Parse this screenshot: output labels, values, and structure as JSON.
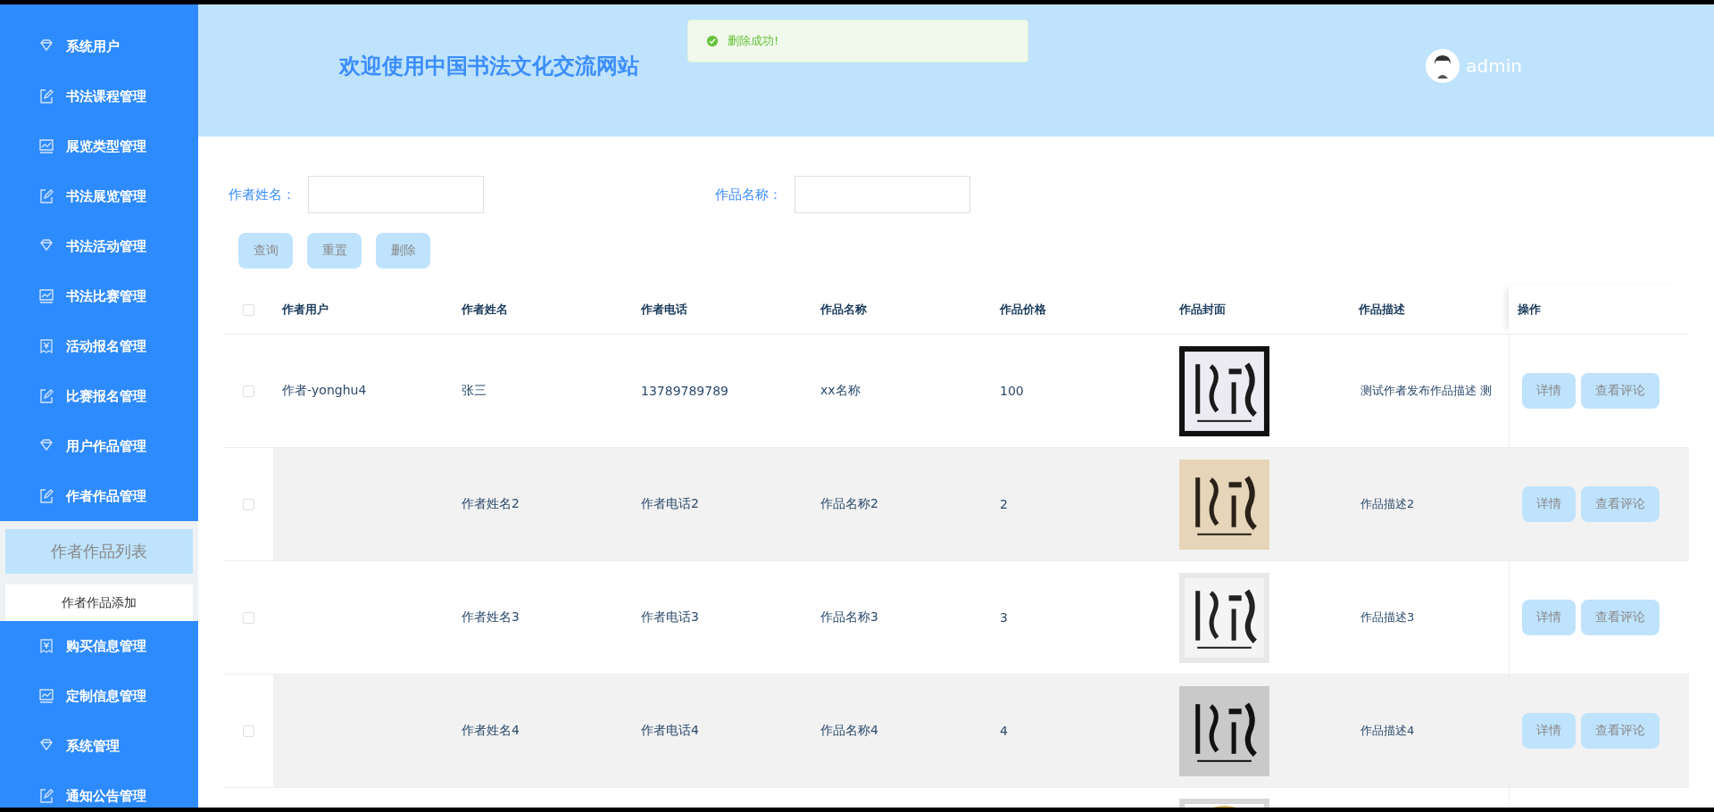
{
  "sidebar": {
    "items": [
      {
        "label": "系统用户",
        "kind": "diamond"
      },
      {
        "label": "书法课程管理",
        "kind": "edit"
      },
      {
        "label": "展览类型管理",
        "kind": "chart"
      },
      {
        "label": "书法展览管理",
        "kind": "edit"
      },
      {
        "label": "书法活动管理",
        "kind": "diamond"
      },
      {
        "label": "书法比赛管理",
        "kind": "chart"
      },
      {
        "label": "活动报名管理",
        "kind": "receipt"
      },
      {
        "label": "比赛报名管理",
        "kind": "edit"
      },
      {
        "label": "用户作品管理",
        "kind": "diamond"
      },
      {
        "label": "作者作品管理",
        "kind": "edit",
        "expanded": true,
        "children": [
          {
            "label": "作者作品列表",
            "selected": true
          },
          {
            "label": "作者作品添加",
            "selected": false
          }
        ]
      },
      {
        "label": "购买信息管理",
        "kind": "receipt"
      },
      {
        "label": "定制信息管理",
        "kind": "chart"
      },
      {
        "label": "系统管理",
        "kind": "diamond"
      },
      {
        "label": "通知公告管理",
        "kind": "edit"
      }
    ]
  },
  "header": {
    "title": "欢迎使用中国书法文化交流网站",
    "user": "admin"
  },
  "toast": {
    "kind": "success",
    "message": "删除成功!"
  },
  "filters": [
    {
      "label": "作者姓名："
    },
    {
      "label": "作品名称："
    }
  ],
  "buttons": [
    "查询",
    "重置",
    "删除"
  ],
  "table": {
    "header_checked": false,
    "columns": [
      "作者用户",
      "作者姓名",
      "作者电话",
      "作品名称",
      "作品价格",
      "作品封面",
      "作品描述",
      "操作"
    ],
    "rows": [
      {
        "checked": false,
        "user": "作者-yonghu4",
        "name": "张三",
        "phone": "13789789789",
        "title": "xx名称",
        "price": "100",
        "cover": {
          "kind": "picture"
        },
        "description": "测试作者发布作品描述 测",
        "actions": [
          "详情",
          "查看评论"
        ]
      },
      {
        "checked": false,
        "name": "作者姓名2",
        "phone": "作者电话2",
        "title": "作品名称2",
        "price": "2",
        "cover": {
          "kind": "picture"
        },
        "description": "作品描述2",
        "actions": [
          "详情",
          "查看评论"
        ]
      },
      {
        "checked": false,
        "name": "作者姓名3",
        "phone": "作者电话3",
        "title": "作品名称3",
        "price": "3",
        "cover": {
          "kind": "picture"
        },
        "description": "作品描述3",
        "actions": [
          "详情",
          "查看评论"
        ]
      },
      {
        "checked": false,
        "name": "作者姓名4",
        "phone": "作者电话4",
        "title": "作品名称4",
        "price": "4",
        "cover": {
          "kind": "picture"
        },
        "description": "作品描述4",
        "actions": [
          "详情",
          "查看评论"
        ]
      },
      {
        "cover": {
          "kind": "picture"
        }
      }
    ]
  }
}
